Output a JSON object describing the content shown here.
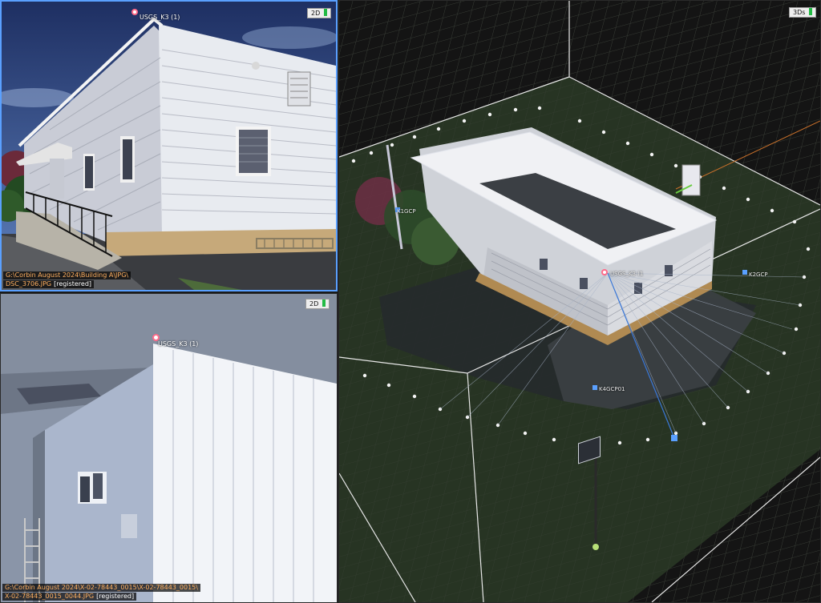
{
  "top_view": {
    "mode": "2D",
    "point_label": "USGS_K3 (1)",
    "path": "G:\\Corbin August 2024\\Building A\\JPG\\",
    "filename": "DSC_3706.JPG",
    "status": "[registered]"
  },
  "bottom_view": {
    "mode": "2D",
    "point_label": "USGS_K3 (1)",
    "path": "G:\\Corbin August 2024\\X-02-78443_0015\\X-02-78443_0015\\",
    "filename": "X-02-78443_0015_0044.JPG",
    "status": "[registered]"
  },
  "view_3d": {
    "mode": "3Ds",
    "gcp_labels": {
      "k3": "USGS_K3 (1",
      "k1": "K1GCP",
      "k2": "K2GCP",
      "k4": "K4GCP01"
    }
  },
  "colors": {
    "selected_border": "#5aa0ff",
    "label_text": "#ffb060",
    "registered_text": "#ffffff",
    "marker": "#ff6b8a",
    "gcp_marker": "#5aa0ff",
    "status_indicator": "#22bb44"
  },
  "icons": [
    "gcp-marker-icon",
    "camera-icon",
    "view-mode-indicator-icon"
  ]
}
